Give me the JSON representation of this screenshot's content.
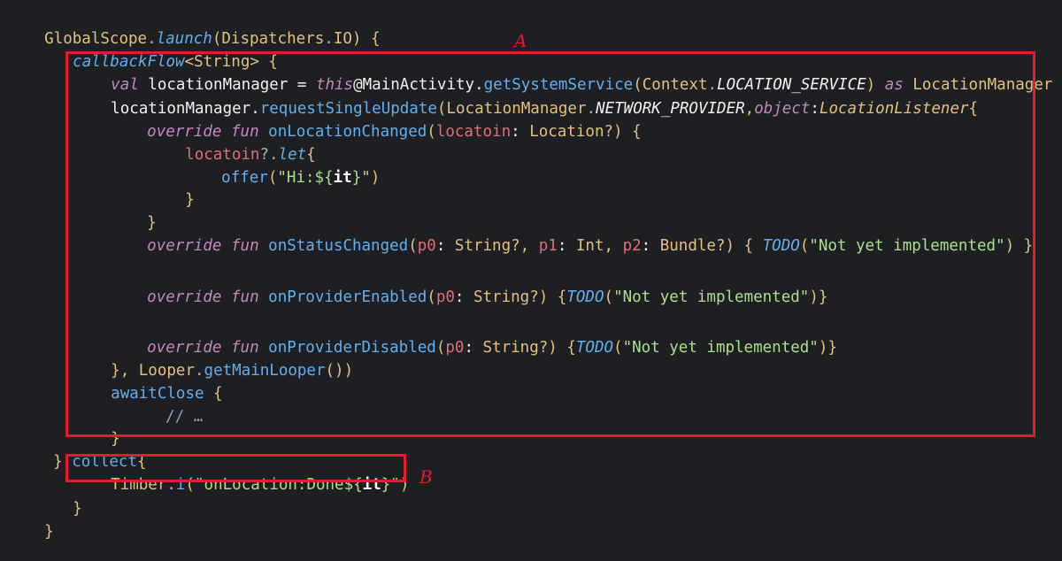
{
  "code_lines": [
    [
      "GlobalScope",
      ".",
      "launch",
      "(",
      "Dispatchers",
      ".",
      "IO",
      ") {"
    ],
    [
      "callbackFlow",
      "<",
      "String",
      "> {"
    ],
    [
      "val",
      " locationManager = ",
      "this",
      "@MainActivity.",
      "getSystemService",
      "(",
      "Context",
      ".",
      "LOCATION_SERVICE",
      ") ",
      "as",
      " LocationManager"
    ],
    [
      "locationManager.",
      "requestSingleUpdate",
      "(",
      "LocationManager",
      ".",
      "NETWORK_PROVIDER",
      ",",
      "object",
      ":",
      "LocationListener",
      "{"
    ],
    [
      "override",
      " ",
      "fun",
      " ",
      "onLocationChanged",
      "(",
      "locatoin",
      ": ",
      "Location",
      "?) {"
    ],
    [
      "locatoin",
      "?.",
      "let",
      "{"
    ],
    [
      "offer",
      "(",
      "\"Hi:${",
      "it",
      "}\"",
      ")"
    ],
    [
      "}"
    ],
    [
      "}"
    ],
    [
      "override",
      " ",
      "fun",
      " ",
      "onStatusChanged",
      "(",
      "p0",
      ": ",
      "String",
      "?, ",
      "p1",
      ": ",
      "Int",
      ", ",
      "p2",
      ": ",
      "Bundle",
      "?) { ",
      "TODO",
      "(",
      "\"Not yet implemented\"",
      ") }"
    ],
    [
      "override",
      " ",
      "fun",
      " ",
      "onProviderEnabled",
      "(",
      "p0",
      ": ",
      "String",
      "?) {",
      "TODO",
      "(",
      "\"Not yet implemented\"",
      ")}"
    ],
    [
      "override",
      " ",
      "fun",
      " ",
      "onProviderDisabled",
      "(",
      "p0",
      ": ",
      "String",
      "?) {",
      "TODO",
      "(",
      "\"Not yet implemented\"",
      ")}"
    ],
    [
      "}, ",
      "Looper",
      ".",
      "getMainLooper",
      "())"
    ],
    [
      "awaitClose",
      " {"
    ],
    [
      "// …"
    ],
    [
      "}"
    ],
    [
      "}.",
      "collect",
      "{"
    ],
    [
      "Timber",
      ".",
      "i",
      "(",
      "\"onLocation:Done${",
      "it",
      "}\"",
      ")"
    ],
    [
      "}"
    ],
    [
      "}"
    ]
  ],
  "annotations": {
    "box_a_label": "A",
    "box_b_label": "B"
  },
  "colors": {
    "highlight_box": "#e8192c",
    "background": "#1e1f22"
  }
}
